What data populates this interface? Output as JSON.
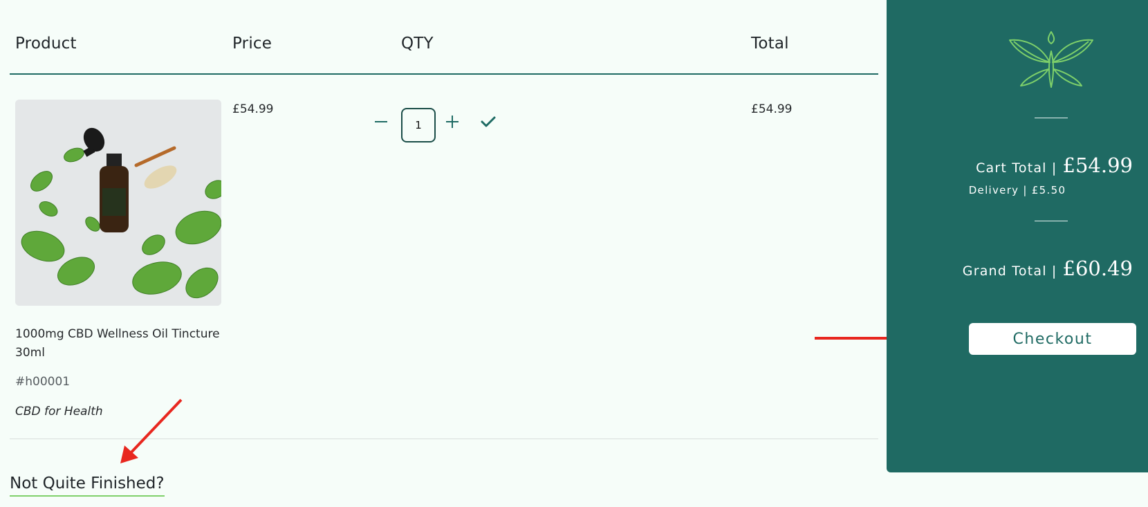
{
  "table": {
    "headers": {
      "product": "Product",
      "price": "Price",
      "qty": "QTY",
      "total": "Total"
    }
  },
  "item": {
    "name": "1000mg CBD Wellness Oil Tincture 30ml",
    "sku": "#h00001",
    "category": "CBD for Health",
    "price": "£54.99",
    "quantity": "1",
    "total": "£54.99",
    "image_alt": "CBD oil bottle with mint leaves"
  },
  "summary": {
    "cart_total_label": "Cart Total |",
    "cart_total_value": "£54.99",
    "delivery": "Delivery | £5.50",
    "grand_total_label": "Grand Total |",
    "grand_total_value": "£60.49",
    "checkout_label": "Checkout"
  },
  "upsell": {
    "title": "Not Quite Finished?"
  },
  "colors": {
    "accent": "#1f6a63",
    "background": "#f6fdf9",
    "logo_green": "#7ed06a",
    "annotation_red": "#e8271f"
  },
  "icons": {
    "decrease": "minus-icon",
    "increase": "plus-icon",
    "confirm": "check-icon",
    "logo": "leaf-drop-logo"
  }
}
